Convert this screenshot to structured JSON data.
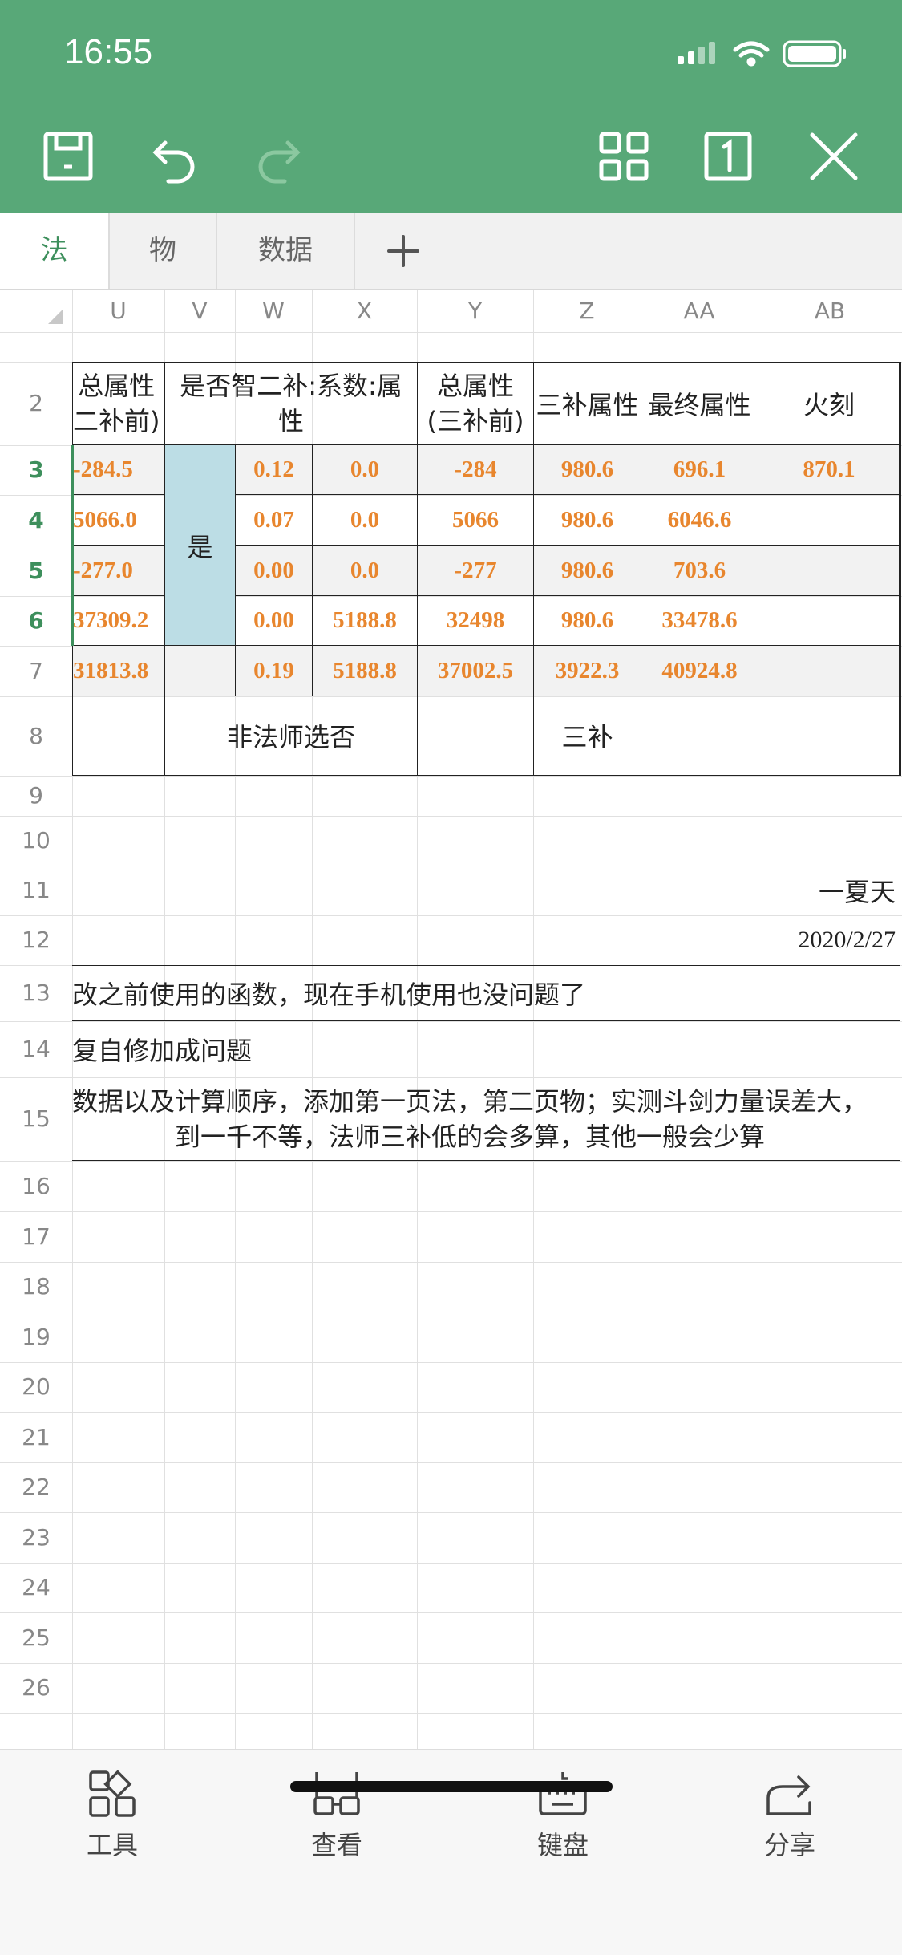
{
  "status": {
    "time": "16:55"
  },
  "tabs": [
    "法",
    "物",
    "数据"
  ],
  "columns": [
    "U",
    "V",
    "W",
    "X",
    "Y",
    "Z",
    "AA",
    "AB"
  ],
  "rows": [
    "2",
    "3",
    "4",
    "5",
    "6",
    "7",
    "8",
    "9",
    "10",
    "11",
    "12",
    "13",
    "14",
    "15",
    "16",
    "17",
    "18",
    "19",
    "20",
    "21",
    "22",
    "23",
    "24",
    "25",
    "26"
  ],
  "headers": {
    "u2": "总属性\n二补前)",
    "vwx2": "是否智二补:系数:属性",
    "y2": "总属性\n(三补前)",
    "z2": "三补属性",
    "aa2": "最终属性",
    "ab2": "火刻"
  },
  "cells": {
    "u3": "-284.5",
    "w3": "0.12",
    "x3": "0.0",
    "y3": "-284",
    "z3": "980.6",
    "aa3": "696.1",
    "ab3": "870.1",
    "u4": "5066.0",
    "w4": "0.07",
    "x4": "0.0",
    "y4": "5066",
    "z4": "980.6",
    "aa4": "6046.6",
    "u5": "-277.0",
    "w5": "0.00",
    "x5": "0.0",
    "y5": "-277",
    "z5": "980.6",
    "aa5": "703.6",
    "u6": "37309.2",
    "w6": "0.00",
    "x6": "5188.8",
    "y6": "32498",
    "z6": "980.6",
    "aa6": "33478.6",
    "u7": "31813.8",
    "w7": "0.19",
    "x7": "5188.8",
    "y7": "37002.5",
    "z7": "3922.3",
    "aa7": "40924.8",
    "v36": "是",
    "vx8": "非法师选否",
    "z8": "三补",
    "ab10": "一夏天",
    "ab11": "2020/2/27",
    "r12": "改之前使用的函数，现在手机使用也没问题了",
    "r13": "复自修加成问题",
    "r14": "数据以及计算顺序，添加第一页法，第二页物；实测斗剑力量误差大，\n到一千不等，法师三补低的会多算，其他一般会少算"
  },
  "bottom": [
    "工具",
    "查看",
    "键盘",
    "分享"
  ]
}
